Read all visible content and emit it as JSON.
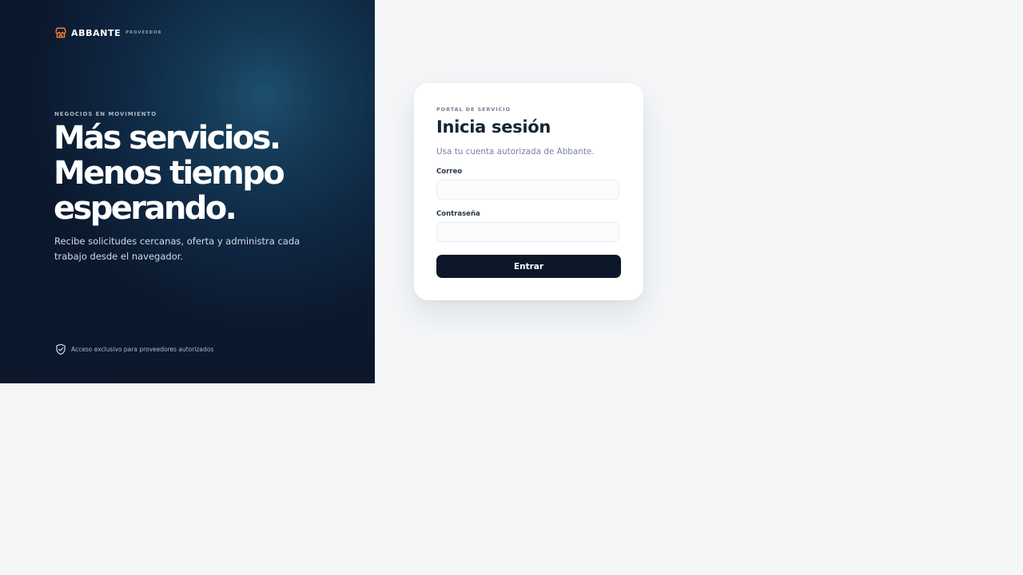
{
  "colors": {
    "page_background": "#f4f6f8",
    "hero_background": "#0b172b",
    "hero_glow": "#1d4f6e",
    "accent": "#f07a35",
    "primary_button": "#0d172a"
  },
  "brand": {
    "icon": "storefront-icon",
    "name": "ABBANTE",
    "tag": "PROVEEDOR"
  },
  "hero": {
    "eyebrow": "NEGOCIOS EN MOVIMIENTO",
    "headline_lines": [
      "Más servicios.",
      "Menos tiempo",
      "esperando."
    ],
    "description": "Recibe solicitudes cercanas, oferta y administra cada trabajo desde el navegador.",
    "access_icon": "shield-check-icon",
    "access_note": "Acceso exclusivo para proveedores autorizados"
  },
  "login": {
    "eyebrow": "PORTAL DE SERVICIO",
    "title": "Inicia sesión",
    "subtitle": "Usa tu cuenta autorizada de Abbante.",
    "email_label": "Correo",
    "email_value": "",
    "email_placeholder": "",
    "password_label": "Contraseña",
    "password_value": "",
    "password_placeholder": "",
    "submit_label": "Entrar"
  }
}
